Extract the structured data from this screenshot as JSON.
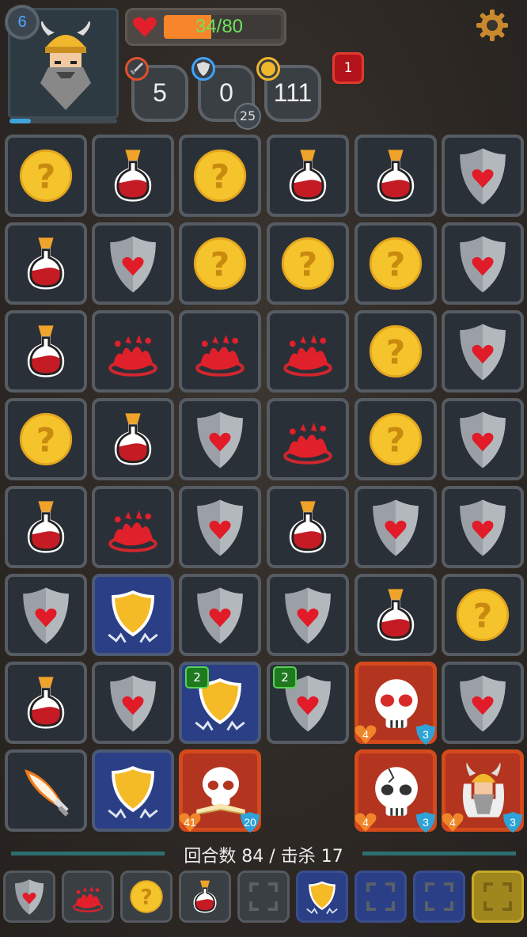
{
  "player": {
    "level": "6",
    "hp_text": "34/80",
    "hp_current": 34,
    "hp_max": 80,
    "xp_fraction": 0.2
  },
  "stats": {
    "attack": "5",
    "armor": "0",
    "armor_bonus": "25",
    "gold": "111",
    "burn": "1"
  },
  "board": {
    "rows": [
      [
        "coin",
        "potion",
        "coin",
        "potion",
        "potion",
        "shield"
      ],
      [
        "potion",
        "shield",
        "coin",
        "coin",
        "coin",
        "shield"
      ],
      [
        "potion",
        "blood",
        "blood",
        "blood",
        "coin",
        "shield"
      ],
      [
        "coin",
        "potion",
        "shield",
        "blood",
        "coin",
        "shield"
      ],
      [
        "potion",
        "blood",
        "shield",
        "potion",
        "shield",
        "shield"
      ],
      [
        "shield",
        "armor",
        "shield",
        "shield",
        "potion",
        "coin"
      ],
      [
        "potion",
        "shield",
        "armor",
        "shield",
        "skull-red-eyes",
        "shield"
      ],
      [
        "sword",
        "armor",
        "boss-skull",
        "empty",
        "skull-cracked",
        "viking-enemy"
      ]
    ],
    "badges": {
      "r6c2": {
        "plus": "2"
      },
      "r6c3": {
        "plus": "2"
      },
      "r6c4": {
        "hp": "4",
        "shield": "3"
      },
      "r7c2": {
        "hp": "41",
        "shield": "20"
      },
      "r7c4": {
        "hp": "4",
        "shield": "3"
      },
      "r7c5": {
        "hp": "4",
        "shield": "3"
      }
    }
  },
  "footer": {
    "turn_text": "回合数 84 / 击杀 17",
    "slots": [
      "shield",
      "blood",
      "coin",
      "potion",
      "empty",
      "armor",
      "empty-blue",
      "empty-blue",
      "gold-empty"
    ]
  },
  "colors": {
    "hp_text": "#6fe35c",
    "hp_fill": "#f7862a",
    "tile_bg": "#2a3038",
    "blue_tile": "#2a3f86",
    "enemy_tile": "#b3351f"
  }
}
